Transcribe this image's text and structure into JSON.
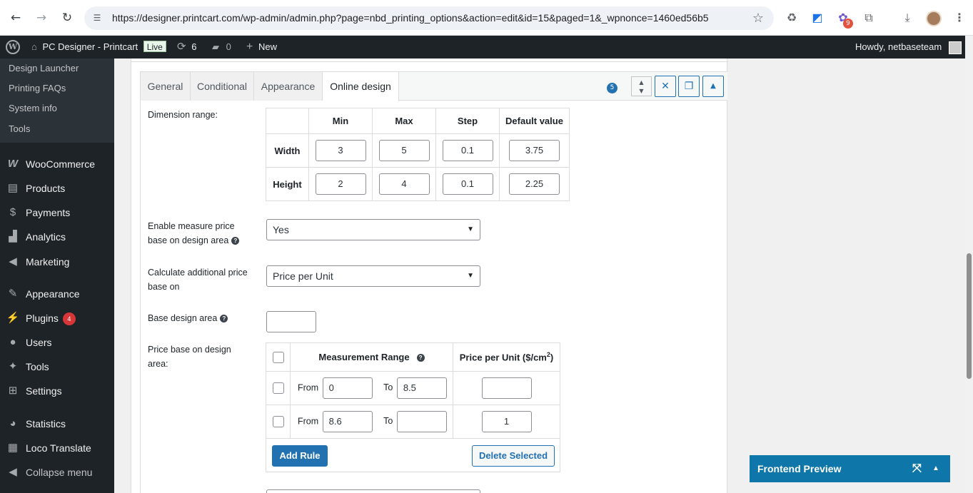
{
  "browser": {
    "url": "https://designer.printcart.com/wp-admin/admin.php?page=nbd_printing_options&action=edit&id=15&paged=1&_wpnonce=1460ed56b5",
    "extension_badge": "9"
  },
  "adminbar": {
    "site_name": "PC Designer - Printcart",
    "live_label": "Live",
    "updates_count": "6",
    "comments_count": "0",
    "new_label": "New",
    "howdy": "Howdy, netbaseteam"
  },
  "sidebar": {
    "submenu": [
      "Design Launcher",
      "Printing FAQs",
      "System info",
      "Tools"
    ],
    "items": [
      {
        "label": "WooCommerce",
        "icon": "woo-icon"
      },
      {
        "label": "Products",
        "icon": "archive-icon"
      },
      {
        "label": "Payments",
        "icon": "dollar-icon"
      },
      {
        "label": "Analytics",
        "icon": "chart-icon"
      },
      {
        "label": "Marketing",
        "icon": "megaphone-icon"
      },
      {
        "label": "Appearance",
        "icon": "brush-icon"
      },
      {
        "label": "Plugins",
        "icon": "plug-icon",
        "badge": "4"
      },
      {
        "label": "Users",
        "icon": "user-icon"
      },
      {
        "label": "Tools",
        "icon": "wrench-icon"
      },
      {
        "label": "Settings",
        "icon": "sliders-icon"
      },
      {
        "label": "Statistics",
        "icon": "pie-icon"
      },
      {
        "label": "Loco Translate",
        "icon": "translate-icon"
      },
      {
        "label": "Collapse menu",
        "icon": "collapse-icon"
      }
    ]
  },
  "tabs": [
    "General",
    "Conditional",
    "Appearance",
    "Online design"
  ],
  "active_tab": "Online design",
  "field_badge": "5",
  "dimension": {
    "label": "Dimension range:",
    "headers": [
      "Min",
      "Max",
      "Step",
      "Default value"
    ],
    "rows": [
      {
        "name": "Width",
        "values": [
          "3",
          "5",
          "0.1",
          "3.75"
        ]
      },
      {
        "name": "Height",
        "values": [
          "2",
          "4",
          "0.1",
          "2.25"
        ]
      }
    ]
  },
  "measure_price": {
    "label_line1": "Enable measure price",
    "label_line2": "base on design area",
    "value": "Yes"
  },
  "additional_price": {
    "label_line1": "Calculate additional price",
    "label_line2": "base on",
    "value": "Price per Unit"
  },
  "base_area": {
    "label": "Base design area",
    "value": ""
  },
  "price_base": {
    "label_line1": "Price base on design",
    "label_line2": "area:",
    "header_range": "Measurement Range",
    "header_price": "Price per Unit ($/cm",
    "header_price_sup": "2",
    "header_price_end": ")",
    "from_label": "From",
    "to_label": "To",
    "rules": [
      {
        "from": "0",
        "to": "8.5",
        "price": ""
      },
      {
        "from": "8.6",
        "to": "",
        "price": "1"
      }
    ],
    "add_rule": "Add Rule",
    "delete_selected": "Delete Selected"
  },
  "frontend_preview": "Frontend Preview"
}
